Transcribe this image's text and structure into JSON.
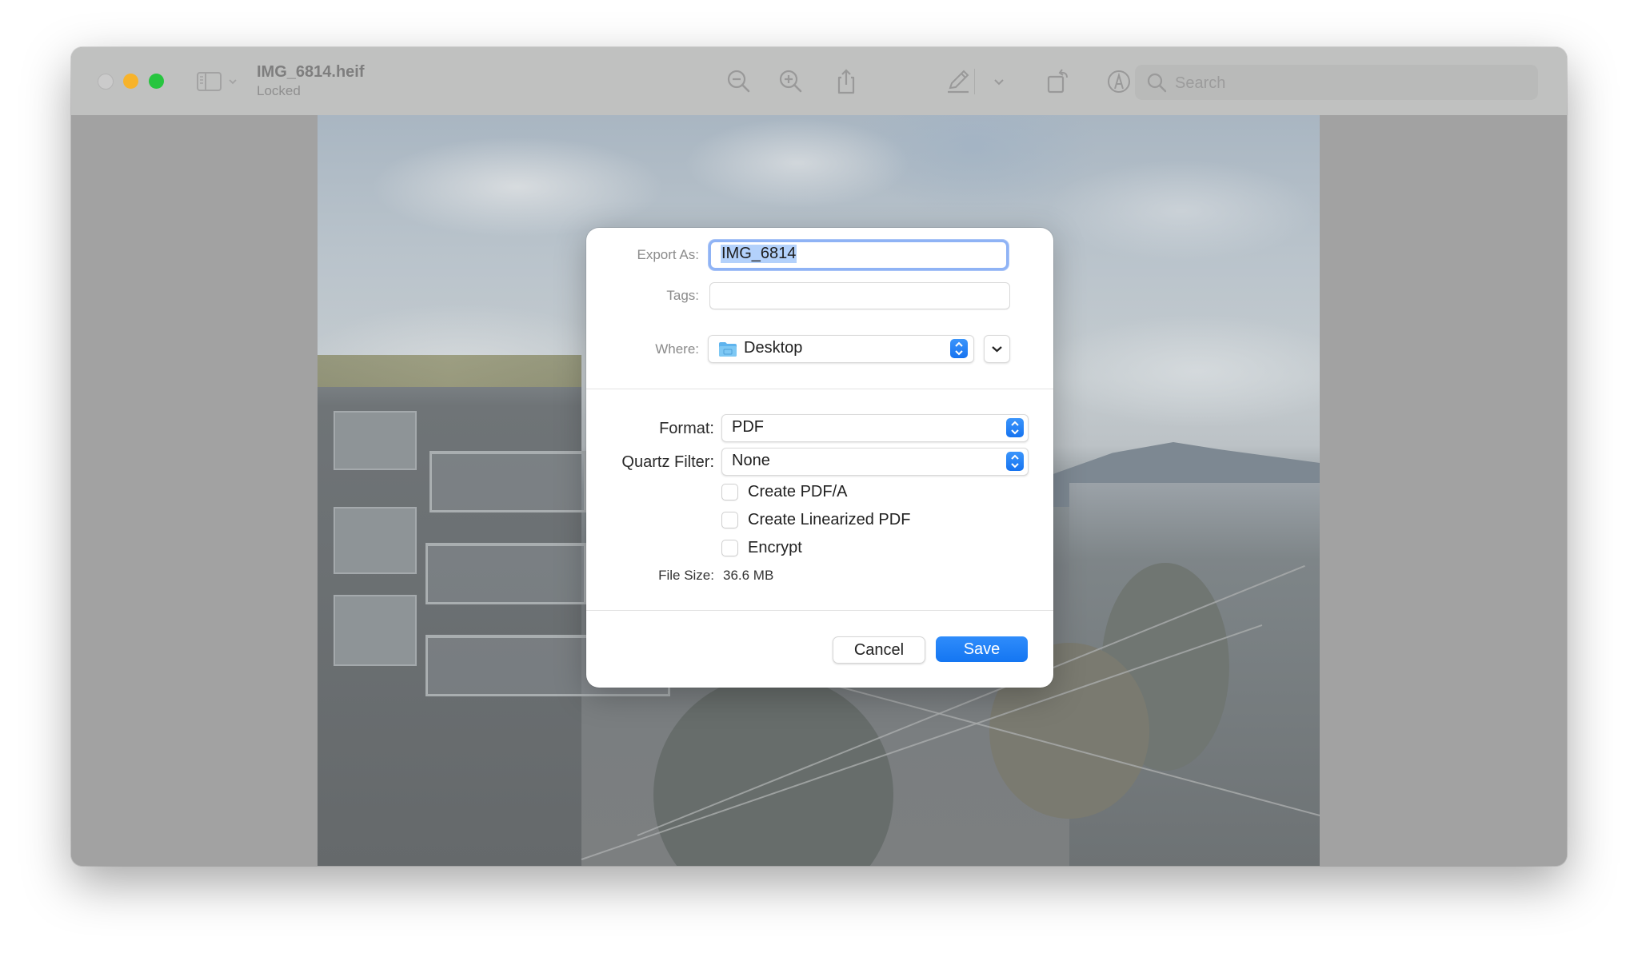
{
  "window": {
    "title": "IMG_6814.heif",
    "subtitle": "Locked",
    "traffic_lights": {
      "close": "#cbcbcb",
      "minimize": "#f7b32b",
      "zoom": "#27c53f"
    }
  },
  "toolbar": {
    "icons": [
      {
        "name": "sidebar-toggle-icon"
      },
      {
        "name": "zoom-out-icon"
      },
      {
        "name": "zoom-in-icon"
      },
      {
        "name": "share-icon"
      },
      {
        "name": "markup-pencil-icon"
      },
      {
        "name": "markup-options-chevron-icon"
      },
      {
        "name": "rotate-left-icon"
      },
      {
        "name": "markup-toolbar-icon"
      }
    ],
    "search_placeholder": "Search"
  },
  "dialog": {
    "export_as_label": "Export As:",
    "export_as_value": "IMG_6814",
    "tags_label": "Tags:",
    "tags_value": "",
    "where_label": "Where:",
    "where_value": "Desktop",
    "format_label": "Format:",
    "format_value": "PDF",
    "quartz_filter_label": "Quartz Filter:",
    "quartz_filter_value": "None",
    "options": [
      {
        "label": "Create PDF/A",
        "checked": false
      },
      {
        "label": "Create Linearized PDF",
        "checked": false
      },
      {
        "label": "Encrypt",
        "checked": false
      }
    ],
    "file_size_label": "File Size:",
    "file_size_value": "36.6 MB",
    "cancel_label": "Cancel",
    "save_label": "Save",
    "accent_color": "#1a7cf5"
  }
}
